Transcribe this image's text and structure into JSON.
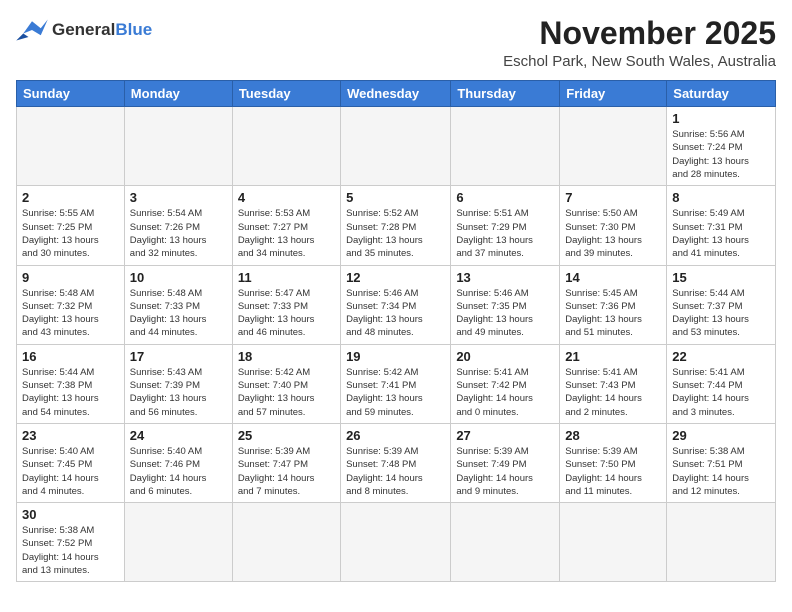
{
  "logo": {
    "text_general": "General",
    "text_blue": "Blue"
  },
  "header": {
    "month": "November 2025",
    "location": "Eschol Park, New South Wales, Australia"
  },
  "weekdays": [
    "Sunday",
    "Monday",
    "Tuesday",
    "Wednesday",
    "Thursday",
    "Friday",
    "Saturday"
  ],
  "weeks": [
    [
      {
        "day": "",
        "info": ""
      },
      {
        "day": "",
        "info": ""
      },
      {
        "day": "",
        "info": ""
      },
      {
        "day": "",
        "info": ""
      },
      {
        "day": "",
        "info": ""
      },
      {
        "day": "",
        "info": ""
      },
      {
        "day": "1",
        "info": "Sunrise: 5:56 AM\nSunset: 7:24 PM\nDaylight: 13 hours\nand 28 minutes."
      }
    ],
    [
      {
        "day": "2",
        "info": "Sunrise: 5:55 AM\nSunset: 7:25 PM\nDaylight: 13 hours\nand 30 minutes."
      },
      {
        "day": "3",
        "info": "Sunrise: 5:54 AM\nSunset: 7:26 PM\nDaylight: 13 hours\nand 32 minutes."
      },
      {
        "day": "4",
        "info": "Sunrise: 5:53 AM\nSunset: 7:27 PM\nDaylight: 13 hours\nand 34 minutes."
      },
      {
        "day": "5",
        "info": "Sunrise: 5:52 AM\nSunset: 7:28 PM\nDaylight: 13 hours\nand 35 minutes."
      },
      {
        "day": "6",
        "info": "Sunrise: 5:51 AM\nSunset: 7:29 PM\nDaylight: 13 hours\nand 37 minutes."
      },
      {
        "day": "7",
        "info": "Sunrise: 5:50 AM\nSunset: 7:30 PM\nDaylight: 13 hours\nand 39 minutes."
      },
      {
        "day": "8",
        "info": "Sunrise: 5:49 AM\nSunset: 7:31 PM\nDaylight: 13 hours\nand 41 minutes."
      }
    ],
    [
      {
        "day": "9",
        "info": "Sunrise: 5:48 AM\nSunset: 7:32 PM\nDaylight: 13 hours\nand 43 minutes."
      },
      {
        "day": "10",
        "info": "Sunrise: 5:48 AM\nSunset: 7:33 PM\nDaylight: 13 hours\nand 44 minutes."
      },
      {
        "day": "11",
        "info": "Sunrise: 5:47 AM\nSunset: 7:33 PM\nDaylight: 13 hours\nand 46 minutes."
      },
      {
        "day": "12",
        "info": "Sunrise: 5:46 AM\nSunset: 7:34 PM\nDaylight: 13 hours\nand 48 minutes."
      },
      {
        "day": "13",
        "info": "Sunrise: 5:46 AM\nSunset: 7:35 PM\nDaylight: 13 hours\nand 49 minutes."
      },
      {
        "day": "14",
        "info": "Sunrise: 5:45 AM\nSunset: 7:36 PM\nDaylight: 13 hours\nand 51 minutes."
      },
      {
        "day": "15",
        "info": "Sunrise: 5:44 AM\nSunset: 7:37 PM\nDaylight: 13 hours\nand 53 minutes."
      }
    ],
    [
      {
        "day": "16",
        "info": "Sunrise: 5:44 AM\nSunset: 7:38 PM\nDaylight: 13 hours\nand 54 minutes."
      },
      {
        "day": "17",
        "info": "Sunrise: 5:43 AM\nSunset: 7:39 PM\nDaylight: 13 hours\nand 56 minutes."
      },
      {
        "day": "18",
        "info": "Sunrise: 5:42 AM\nSunset: 7:40 PM\nDaylight: 13 hours\nand 57 minutes."
      },
      {
        "day": "19",
        "info": "Sunrise: 5:42 AM\nSunset: 7:41 PM\nDaylight: 13 hours\nand 59 minutes."
      },
      {
        "day": "20",
        "info": "Sunrise: 5:41 AM\nSunset: 7:42 PM\nDaylight: 14 hours\nand 0 minutes."
      },
      {
        "day": "21",
        "info": "Sunrise: 5:41 AM\nSunset: 7:43 PM\nDaylight: 14 hours\nand 2 minutes."
      },
      {
        "day": "22",
        "info": "Sunrise: 5:41 AM\nSunset: 7:44 PM\nDaylight: 14 hours\nand 3 minutes."
      }
    ],
    [
      {
        "day": "23",
        "info": "Sunrise: 5:40 AM\nSunset: 7:45 PM\nDaylight: 14 hours\nand 4 minutes."
      },
      {
        "day": "24",
        "info": "Sunrise: 5:40 AM\nSunset: 7:46 PM\nDaylight: 14 hours\nand 6 minutes."
      },
      {
        "day": "25",
        "info": "Sunrise: 5:39 AM\nSunset: 7:47 PM\nDaylight: 14 hours\nand 7 minutes."
      },
      {
        "day": "26",
        "info": "Sunrise: 5:39 AM\nSunset: 7:48 PM\nDaylight: 14 hours\nand 8 minutes."
      },
      {
        "day": "27",
        "info": "Sunrise: 5:39 AM\nSunset: 7:49 PM\nDaylight: 14 hours\nand 9 minutes."
      },
      {
        "day": "28",
        "info": "Sunrise: 5:39 AM\nSunset: 7:50 PM\nDaylight: 14 hours\nand 11 minutes."
      },
      {
        "day": "29",
        "info": "Sunrise: 5:38 AM\nSunset: 7:51 PM\nDaylight: 14 hours\nand 12 minutes."
      }
    ],
    [
      {
        "day": "30",
        "info": "Sunrise: 5:38 AM\nSunset: 7:52 PM\nDaylight: 14 hours\nand 13 minutes."
      },
      {
        "day": "",
        "info": ""
      },
      {
        "day": "",
        "info": ""
      },
      {
        "day": "",
        "info": ""
      },
      {
        "day": "",
        "info": ""
      },
      {
        "day": "",
        "info": ""
      },
      {
        "day": "",
        "info": ""
      }
    ]
  ]
}
